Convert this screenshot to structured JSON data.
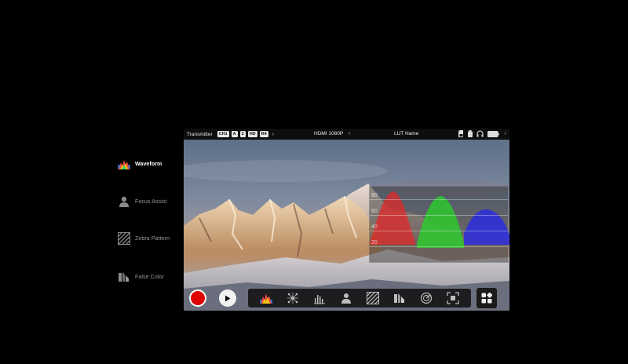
{
  "features": [
    {
      "label": "Waveform",
      "icon": "waveform-icon",
      "active": true
    },
    {
      "label": "Focus Assist",
      "icon": "focus-assist-icon",
      "active": false
    },
    {
      "label": "Zebra Pattern",
      "icon": "zebra-pattern-icon",
      "active": false
    },
    {
      "label": "False Color",
      "icon": "false-color-icon",
      "active": false
    }
  ],
  "topbar": {
    "transmitter": "Transmitter",
    "chips": [
      "CH1",
      "A",
      "2",
      "HD",
      "R4"
    ],
    "hdmi": "HDMI 1080P",
    "lut": "LUT Name"
  },
  "waveform": {
    "grid_labels": [
      "80",
      "60",
      "40",
      "20"
    ],
    "channels": [
      "red",
      "green",
      "blue"
    ]
  },
  "toolbar": {
    "tools": [
      "waveform-icon",
      "vectorscope-icon",
      "histogram-icon",
      "focus-assist-icon",
      "zebra-pattern-icon",
      "false-color-icon",
      "audio-meter-icon",
      "frame-guide-icon"
    ]
  },
  "colors": {
    "record": "#e00000",
    "background": "#000000"
  }
}
